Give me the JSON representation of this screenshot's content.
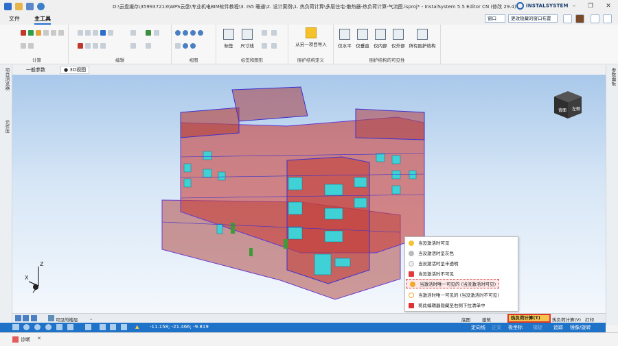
{
  "window": {
    "title": "D:\\云盘缓存\\359937213\\WPS云盘\\专业机电BIM软件教程\\3. IS5 暖通\\2. 设计案例\\1. 热负荷计算\\多层住宅-散热器-热负荷计算-气流图.isproj* - InstalSystem 5.5 Editor CN (修改 29.4)",
    "brand": "INSTALSYSTEM"
  },
  "menu": {
    "file": "文件",
    "main_tools": "主工具",
    "window_select": "窗口",
    "layout_select": "更改隐藏的窗口布置"
  },
  "ribbon": {
    "groups": [
      "计算",
      "编辑",
      "视图",
      "标签和图形",
      "围护结构定义",
      "围护结构的可见性"
    ],
    "label_btn": "标签",
    "dimension_btn": "尺寸线",
    "import_btn": "从另一项目导入",
    "horizontal_btn": "仅水平",
    "vertical_btn": "仅垂直",
    "inner_btn": "仅内部",
    "outer_btn": "仅外部",
    "all_btn": "所有围护结构"
  },
  "doc_tabs": {
    "general": "一般参数",
    "view3d": "● 3D视图"
  },
  "left_panel": {
    "project_manager": "项目浏览器",
    "library": "元件库"
  },
  "right_panel": {
    "properties": "参数面板"
  },
  "viewcube": {
    "left_face": "背面",
    "right_face": "左侧"
  },
  "axes": {
    "x": "X",
    "y": "Y",
    "z": "Z"
  },
  "context_menu": {
    "items": [
      "当没激活时可见",
      "当没激活时呈灰色",
      "当没激活时呈半透明",
      "当没激活时不可见",
      "当激活时唯一可见的 (当没激活时可见)",
      "当激活时唯一可见的 (当没激活时不可见)",
      "将此编辑器隐藏至右侧下拉清单中"
    ],
    "highlighted_index": 4
  },
  "status": {
    "visible_floors": "可见的楼层",
    "floorplan": "底图",
    "building": "建筑",
    "heat_calc": "热负荷计算(T)",
    "heat_calc_v": "热负荷计算(V)",
    "print": "打印",
    "coords": "-11.158; -21.466; -9.819",
    "ortho": "正交",
    "snap": "极坐标",
    "grid": "捕捉",
    "track": "追踪",
    "hint": "镜像/旋转",
    "polarline": "定向线"
  },
  "bottom": {
    "diagnostics": "诊断"
  },
  "colors": {
    "accent": "#1f6fd0",
    "status_blue": "#1e72c8",
    "highlight_red": "#e0362c",
    "building_red": "#c0392b",
    "window_cyan": "#3fd1d6"
  }
}
